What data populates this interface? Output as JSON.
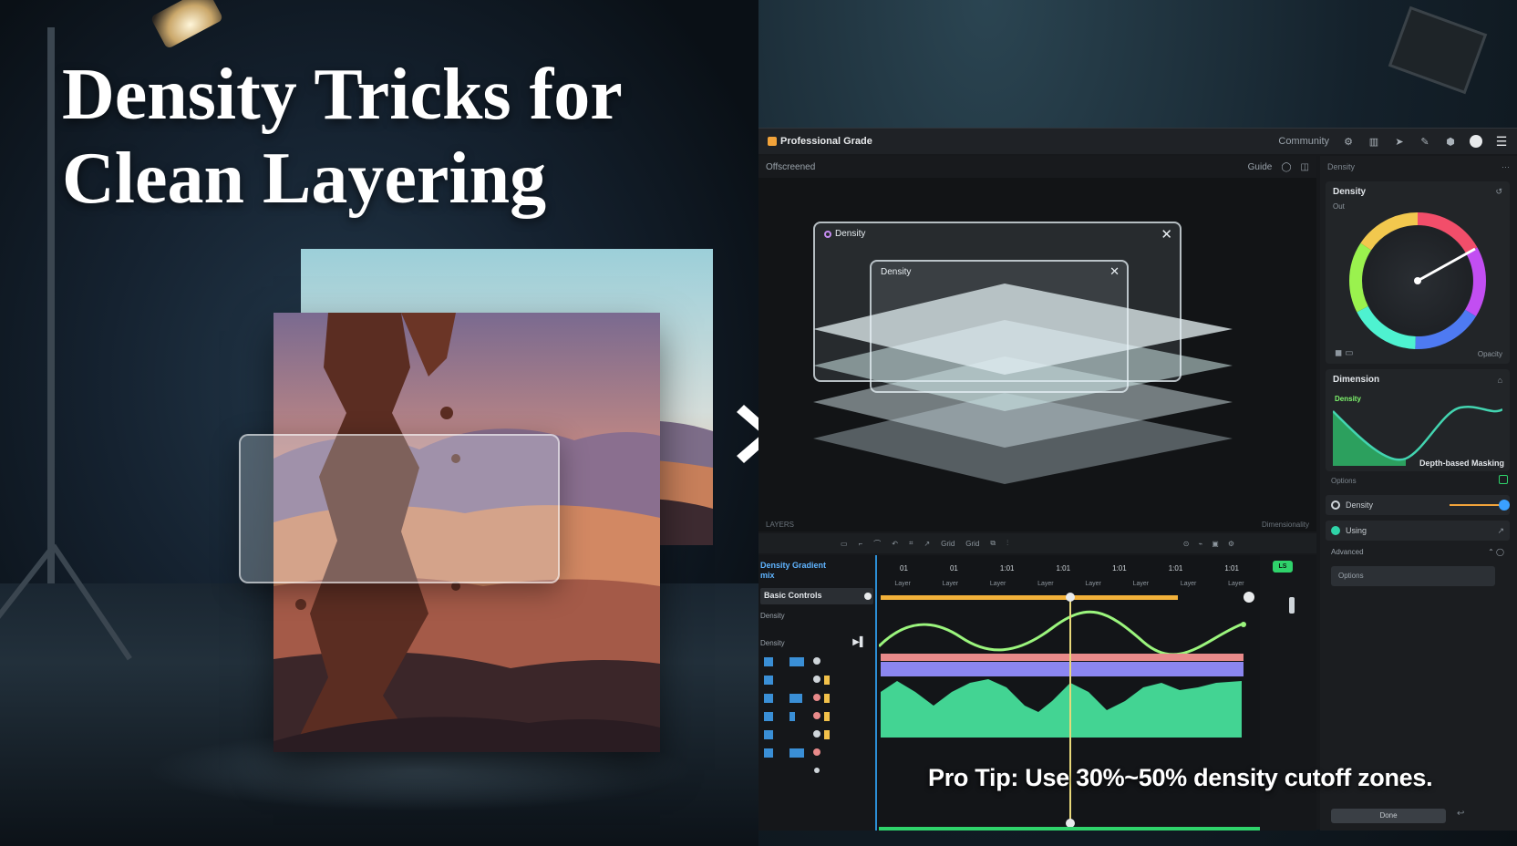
{
  "headline": {
    "line1": "Density Tricks for",
    "line2": "Clean Layering"
  },
  "tip": "Pro Tip: Use 30%~50% density cutoff zones.",
  "app": {
    "title": "Professional Grade",
    "titlebar_right": "Community",
    "viewer": {
      "label": "Offscreened",
      "right_label": "Guide",
      "footer_left": "LAYERS",
      "footer_right": "Dimensionality",
      "dialog_outer_title": "Density",
      "dialog_inner_title": "Density"
    },
    "toolbar": {
      "item1": "Grid",
      "item2": "Grid"
    },
    "timeline": {
      "panel_title": "Density Gradient\nmix",
      "track_selected": "Basic Controls",
      "track2": "Density",
      "track3": "Density",
      "ruler": [
        "01",
        "01",
        "1:01",
        "1:01",
        "1:01",
        "1:01",
        "1:01"
      ],
      "ruler_sub": [
        "Layer",
        "Layer",
        "Layer",
        "Layer",
        "Layer",
        "Layer",
        "Layer",
        "Layer"
      ],
      "badge": "LS"
    },
    "side": {
      "header": "Density",
      "wheel_title": "Density",
      "wheel_sub": "Out",
      "wheel_footer": "Opacity",
      "curve_title": "Dimension",
      "curve_label": "Density",
      "curve_caption": "Depth-based Masking",
      "section_label": "Options",
      "row1": "Density",
      "row2": "Using",
      "row3": "Advanced",
      "field": "Options",
      "button": "Done"
    }
  },
  "colors": {
    "accent_blue": "#2c8fd6",
    "accent_green": "#2fd36b",
    "curve_green": "#7ef56d",
    "track_pink": "#e88a8a",
    "track_purple": "#8b86f0",
    "waveform": "#43d493",
    "playhead": "#e8d87a"
  }
}
